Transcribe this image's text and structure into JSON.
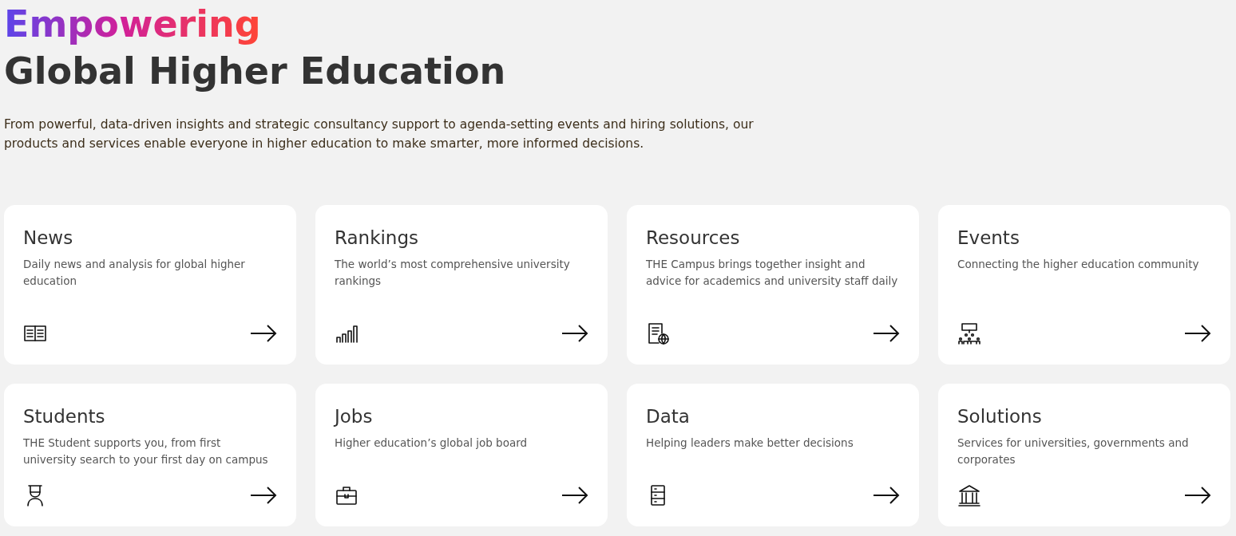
{
  "hero": {
    "highlight": "Empowering",
    "title": "Global Higher Education",
    "intro": "From powerful, data-driven insights and strategic consultancy support to agenda-setting events and hiring solutions, our products and services enable everyone in higher education to make smarter, more informed decisions."
  },
  "cards": [
    {
      "title": "News",
      "description": "Daily news and analysis for global higher education"
    },
    {
      "title": "Rankings",
      "description": "The world’s most comprehensive university rankings"
    },
    {
      "title": "Resources",
      "description": "THE Campus brings together insight and advice for academics and university staff daily"
    },
    {
      "title": "Events",
      "description": "Connecting the higher education community"
    },
    {
      "title": "Students",
      "description": "THE Student supports you, from first university search to your first day on campus"
    },
    {
      "title": "Jobs",
      "description": "Higher education’s global job board"
    },
    {
      "title": "Data",
      "description": "Helping leaders make better decisions"
    },
    {
      "title": "Solutions",
      "description": "Services for universities, governments and corporates"
    }
  ]
}
